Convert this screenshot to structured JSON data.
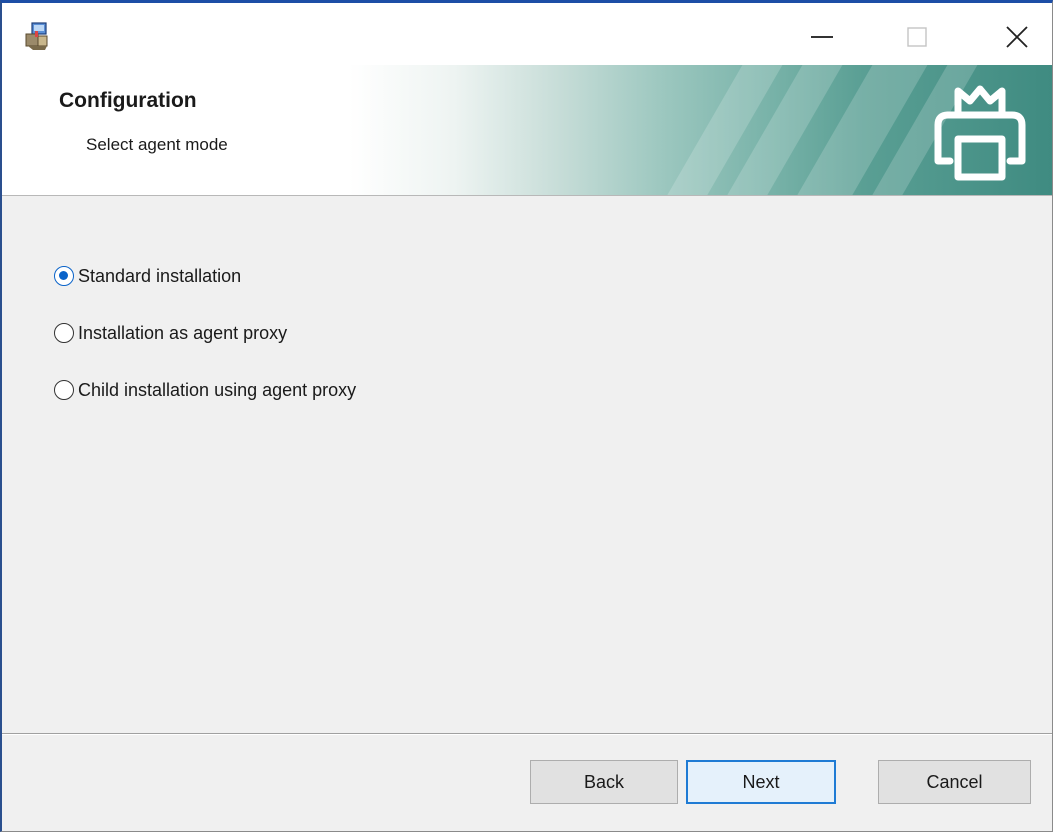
{
  "window": {
    "minimize_icon": "minimize-icon",
    "maximize_icon": "maximize-icon",
    "close_icon": "close-icon",
    "app_icon": "installer-package-icon",
    "accent_color": "#1d4ea6"
  },
  "header": {
    "title": "Configuration",
    "subtitle": "Select agent mode",
    "logo_icon": "printer-crown-icon",
    "gradient_end_color": "#3f8b81"
  },
  "agent_mode": {
    "selected_index": 0,
    "options": [
      {
        "label": "Standard installation",
        "checked": true
      },
      {
        "label": "Installation as agent proxy",
        "checked": false
      },
      {
        "label": "Child installation using agent proxy",
        "checked": false
      }
    ],
    "radio_color": "#0a63c9"
  },
  "footer": {
    "back_label": "Back",
    "next_label": "Next",
    "cancel_label": "Cancel",
    "default_button_border_color": "#1f7bd4"
  }
}
